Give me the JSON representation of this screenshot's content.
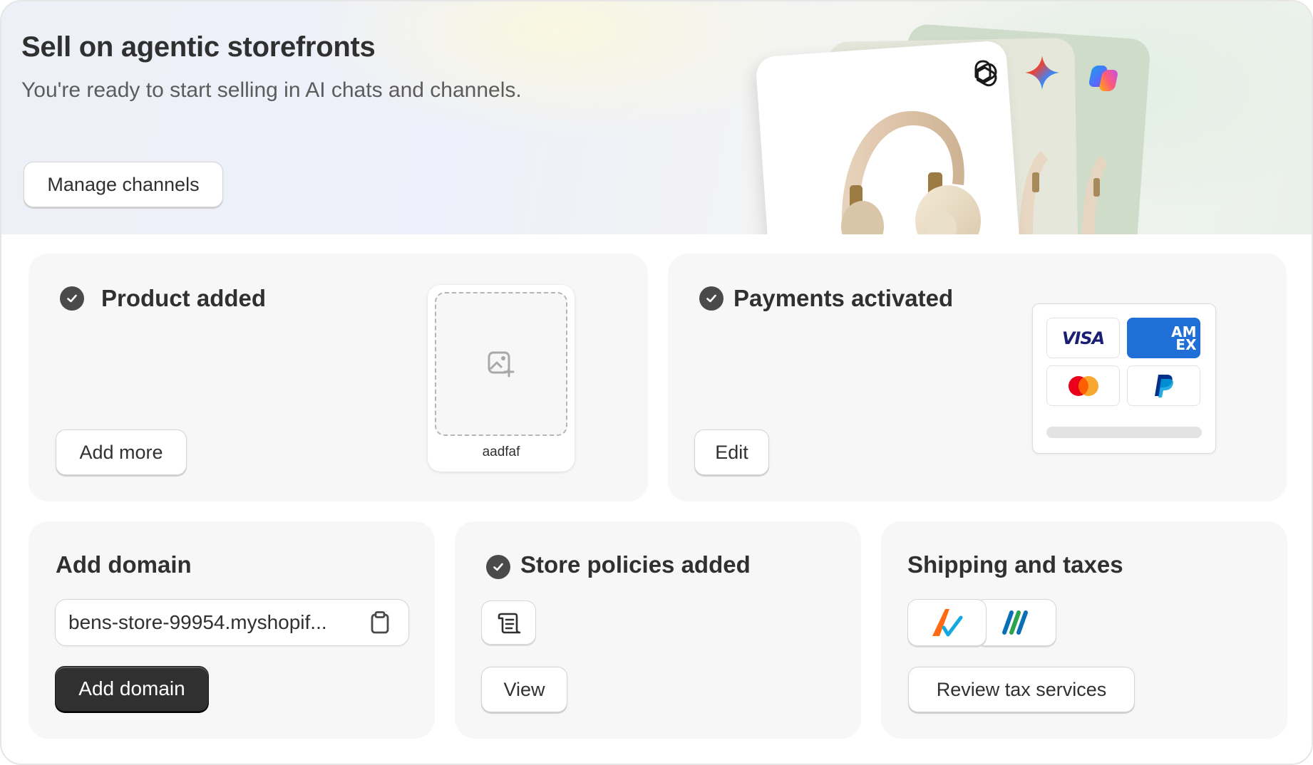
{
  "hero": {
    "title": "Sell on agentic storefronts",
    "subtitle": "You're ready to start selling in AI chats and channels.",
    "manage_button": "Manage channels",
    "channel_logos": [
      "openai-icon",
      "gemini-icon",
      "copilot-icon"
    ]
  },
  "product_card": {
    "title": "Product added",
    "add_more_button": "Add more",
    "product_name": "aadfaf"
  },
  "payments_card": {
    "title": "Payments activated",
    "edit_button": "Edit",
    "methods": [
      "VISA",
      "AMEX",
      "Mastercard",
      "PayPal"
    ],
    "visa_text": "VISA",
    "amex_text": "AM EX"
  },
  "domain_card": {
    "title": "Add domain",
    "domain_value": "bens-store-99954.myshopif...",
    "add_button": "Add domain"
  },
  "policies_card": {
    "title": "Store policies added",
    "view_button": "View"
  },
  "shipping_card": {
    "title": "Shipping and taxes",
    "review_button": "Review tax services"
  },
  "colors": {
    "primary_dark": "#303030",
    "card_bg": "#f7f7f7",
    "visa_blue": "#1a1f71",
    "amex_blue": "#1f6fd6",
    "mastercard_red": "#eb001b",
    "mastercard_orange": "#f79e1b",
    "paypal_blue": "#003087"
  }
}
